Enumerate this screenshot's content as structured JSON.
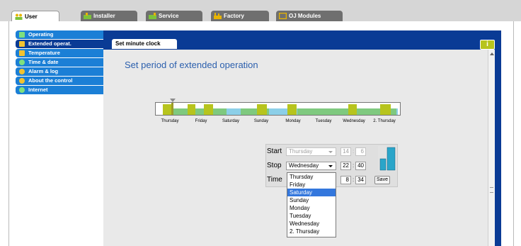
{
  "top_tabs": [
    {
      "label": "User",
      "icon": "users-icon",
      "active": true
    },
    {
      "label": "Installer",
      "icon": "installer-icon",
      "active": false
    },
    {
      "label": "Service",
      "icon": "service-icon",
      "active": false
    },
    {
      "label": "Factory",
      "icon": "factory-icon",
      "active": false
    },
    {
      "label": "OJ Modules",
      "icon": "modules-icon",
      "active": false
    }
  ],
  "sidebar": {
    "items": [
      {
        "label": "Operating",
        "icon": "operating-icon"
      },
      {
        "label": "Extended operat.",
        "icon": "hourglass-icon"
      },
      {
        "label": "Temperature",
        "icon": "thermometer-icon"
      },
      {
        "label": "Time & date",
        "icon": "clock-icon"
      },
      {
        "label": "Alarm & log",
        "icon": "alarm-bell-icon"
      },
      {
        "label": "About the control",
        "icon": "question-icon"
      },
      {
        "label": "Internet",
        "icon": "globe-icon"
      }
    ],
    "active_index": 1
  },
  "panel": {
    "tab_label": "Set minute clock",
    "info_label": "i",
    "heading": "Set period of extended operation"
  },
  "timeline": {
    "day_labels": [
      "Thursday",
      "Friday",
      "Saturday",
      "Sunday",
      "Monday",
      "Tuesday",
      "Wednesday",
      "2. Thursday"
    ]
  },
  "form": {
    "start_label": "Start",
    "start_day": "Thursday",
    "start_hour": "14",
    "start_minute": "6",
    "stop_label": "Stop",
    "stop_day": "Wednesday",
    "stop_hour": "22",
    "stop_minute": "40",
    "time_label": "Time",
    "time_hour": "8",
    "time_minute": "34",
    "save_label": "Save",
    "colon": ":"
  },
  "dropdown": {
    "options": [
      "Thursday",
      "Friday",
      "Saturday",
      "Sunday",
      "Monday",
      "Tuesday",
      "Wednesday",
      "2. Thursday"
    ],
    "highlighted": "Saturday"
  },
  "colors": {
    "panel_blue": "#0a3b95",
    "menu_blue": "#1b7fd6",
    "heading_blue": "#2b5fad",
    "olive": "#b7c41d",
    "timeline_green": "#7fc97f",
    "timeline_blue": "#8ccfe8",
    "selection": "#3377dd"
  }
}
